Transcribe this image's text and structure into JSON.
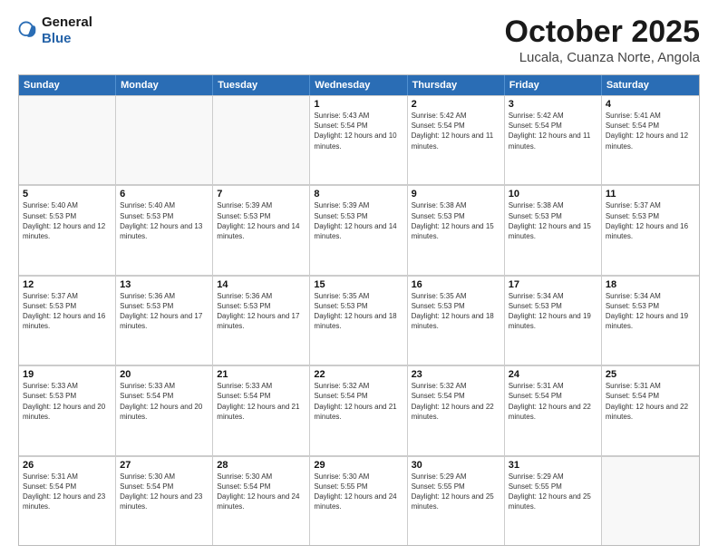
{
  "header": {
    "logo": {
      "general": "General",
      "blue": "Blue"
    },
    "title": "October 2025",
    "location": "Lucala, Cuanza Norte, Angola"
  },
  "days_of_week": [
    "Sunday",
    "Monday",
    "Tuesday",
    "Wednesday",
    "Thursday",
    "Friday",
    "Saturday"
  ],
  "weeks": [
    [
      {
        "day": "",
        "empty": true
      },
      {
        "day": "",
        "empty": true
      },
      {
        "day": "",
        "empty": true
      },
      {
        "day": "1",
        "sunrise": "5:43 AM",
        "sunset": "5:54 PM",
        "daylight": "12 hours and 10 minutes."
      },
      {
        "day": "2",
        "sunrise": "5:42 AM",
        "sunset": "5:54 PM",
        "daylight": "12 hours and 11 minutes."
      },
      {
        "day": "3",
        "sunrise": "5:42 AM",
        "sunset": "5:54 PM",
        "daylight": "12 hours and 11 minutes."
      },
      {
        "day": "4",
        "sunrise": "5:41 AM",
        "sunset": "5:54 PM",
        "daylight": "12 hours and 12 minutes."
      }
    ],
    [
      {
        "day": "5",
        "sunrise": "5:40 AM",
        "sunset": "5:53 PM",
        "daylight": "12 hours and 12 minutes."
      },
      {
        "day": "6",
        "sunrise": "5:40 AM",
        "sunset": "5:53 PM",
        "daylight": "12 hours and 13 minutes."
      },
      {
        "day": "7",
        "sunrise": "5:39 AM",
        "sunset": "5:53 PM",
        "daylight": "12 hours and 14 minutes."
      },
      {
        "day": "8",
        "sunrise": "5:39 AM",
        "sunset": "5:53 PM",
        "daylight": "12 hours and 14 minutes."
      },
      {
        "day": "9",
        "sunrise": "5:38 AM",
        "sunset": "5:53 PM",
        "daylight": "12 hours and 15 minutes."
      },
      {
        "day": "10",
        "sunrise": "5:38 AM",
        "sunset": "5:53 PM",
        "daylight": "12 hours and 15 minutes."
      },
      {
        "day": "11",
        "sunrise": "5:37 AM",
        "sunset": "5:53 PM",
        "daylight": "12 hours and 16 minutes."
      }
    ],
    [
      {
        "day": "12",
        "sunrise": "5:37 AM",
        "sunset": "5:53 PM",
        "daylight": "12 hours and 16 minutes."
      },
      {
        "day": "13",
        "sunrise": "5:36 AM",
        "sunset": "5:53 PM",
        "daylight": "12 hours and 17 minutes."
      },
      {
        "day": "14",
        "sunrise": "5:36 AM",
        "sunset": "5:53 PM",
        "daylight": "12 hours and 17 minutes."
      },
      {
        "day": "15",
        "sunrise": "5:35 AM",
        "sunset": "5:53 PM",
        "daylight": "12 hours and 18 minutes."
      },
      {
        "day": "16",
        "sunrise": "5:35 AM",
        "sunset": "5:53 PM",
        "daylight": "12 hours and 18 minutes."
      },
      {
        "day": "17",
        "sunrise": "5:34 AM",
        "sunset": "5:53 PM",
        "daylight": "12 hours and 19 minutes."
      },
      {
        "day": "18",
        "sunrise": "5:34 AM",
        "sunset": "5:53 PM",
        "daylight": "12 hours and 19 minutes."
      }
    ],
    [
      {
        "day": "19",
        "sunrise": "5:33 AM",
        "sunset": "5:53 PM",
        "daylight": "12 hours and 20 minutes."
      },
      {
        "day": "20",
        "sunrise": "5:33 AM",
        "sunset": "5:54 PM",
        "daylight": "12 hours and 20 minutes."
      },
      {
        "day": "21",
        "sunrise": "5:33 AM",
        "sunset": "5:54 PM",
        "daylight": "12 hours and 21 minutes."
      },
      {
        "day": "22",
        "sunrise": "5:32 AM",
        "sunset": "5:54 PM",
        "daylight": "12 hours and 21 minutes."
      },
      {
        "day": "23",
        "sunrise": "5:32 AM",
        "sunset": "5:54 PM",
        "daylight": "12 hours and 22 minutes."
      },
      {
        "day": "24",
        "sunrise": "5:31 AM",
        "sunset": "5:54 PM",
        "daylight": "12 hours and 22 minutes."
      },
      {
        "day": "25",
        "sunrise": "5:31 AM",
        "sunset": "5:54 PM",
        "daylight": "12 hours and 22 minutes."
      }
    ],
    [
      {
        "day": "26",
        "sunrise": "5:31 AM",
        "sunset": "5:54 PM",
        "daylight": "12 hours and 23 minutes."
      },
      {
        "day": "27",
        "sunrise": "5:30 AM",
        "sunset": "5:54 PM",
        "daylight": "12 hours and 23 minutes."
      },
      {
        "day": "28",
        "sunrise": "5:30 AM",
        "sunset": "5:54 PM",
        "daylight": "12 hours and 24 minutes."
      },
      {
        "day": "29",
        "sunrise": "5:30 AM",
        "sunset": "5:55 PM",
        "daylight": "12 hours and 24 minutes."
      },
      {
        "day": "30",
        "sunrise": "5:29 AM",
        "sunset": "5:55 PM",
        "daylight": "12 hours and 25 minutes."
      },
      {
        "day": "31",
        "sunrise": "5:29 AM",
        "sunset": "5:55 PM",
        "daylight": "12 hours and 25 minutes."
      },
      {
        "day": "",
        "empty": true
      }
    ]
  ]
}
